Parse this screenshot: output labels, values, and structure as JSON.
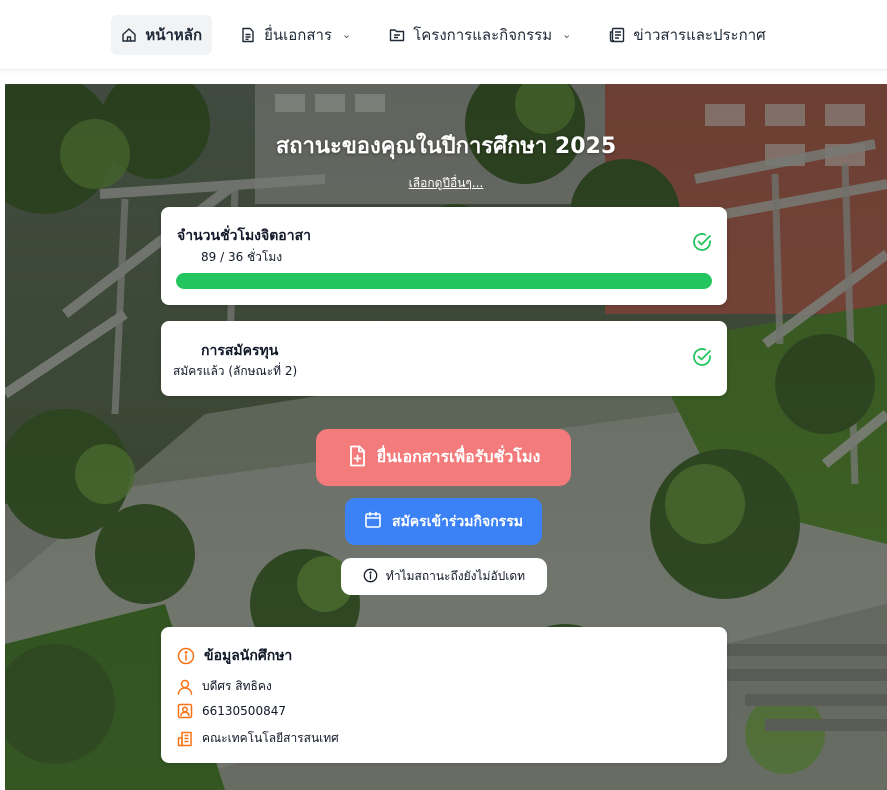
{
  "nav": {
    "home": "หน้าหลัก",
    "submit": "ยื่นเอกสาร",
    "projects": "โครงการและกิจกรรม",
    "news": "ข่าวสารและประกาศ",
    "chevron": "⌄"
  },
  "hero": {
    "title": "สถานะของคุณในปีการศึกษา 2025",
    "select_year_link": "เลือกดูปีอื่นๆ..."
  },
  "volunteer_hours": {
    "title": "จำนวนชั่วโมงจิตอาสา",
    "value": "89 / 36 ชั่วโมง",
    "progress_percent": 100,
    "status_icon": "check-circle-icon"
  },
  "scholarship": {
    "title": "การสมัครทุน",
    "status": "สมัครแล้ว (ลักษณะที่ 2)",
    "status_icon": "check-circle-icon"
  },
  "actions": {
    "submit_documents": "ยื่นเอกสารเพื่อรับชั่วโมง",
    "join_activity": "สมัครเข้าร่วมกิจกรรม",
    "why_not_updated": "ทำไมสถานะถึงยังไม่อัปเดท"
  },
  "student_info": {
    "title": "ข้อมูลนักศึกษา",
    "name": "บดีศร สิทธิคง",
    "student_id": "66130500847",
    "faculty": "คณะเทคโนโลยีสารสนเทศ"
  },
  "colors": {
    "accent_orange": "#f97316",
    "success_green": "#22c55e",
    "primary_red": "#f47b7b",
    "primary_blue": "#3b82f6"
  }
}
